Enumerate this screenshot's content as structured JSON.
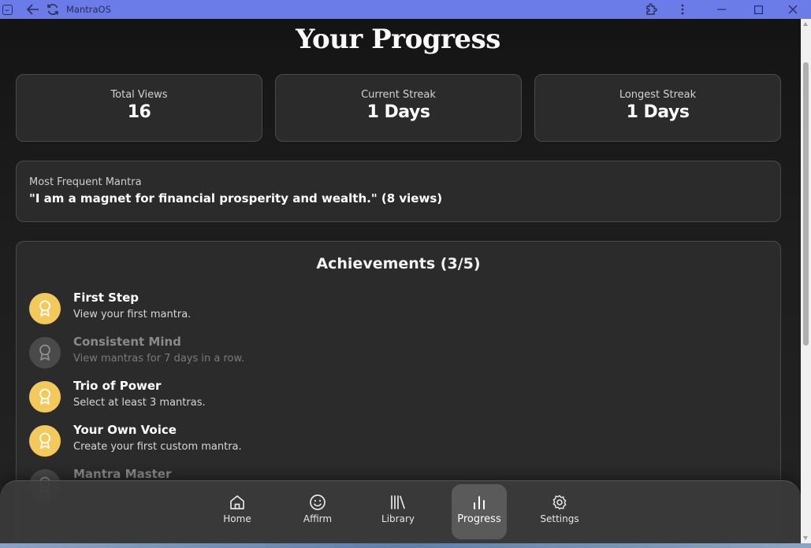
{
  "window": {
    "title": "MantraOS"
  },
  "page": {
    "title": "Your Progress"
  },
  "stats": [
    {
      "label": "Total Views",
      "value": "16"
    },
    {
      "label": "Current Streak",
      "value": "1 Days"
    },
    {
      "label": "Longest Streak",
      "value": "1 Days"
    }
  ],
  "most_frequent": {
    "label": "Most Frequent Mantra",
    "value": "\"I am a magnet for financial prosperity and wealth.\" (8 views)"
  },
  "achievements": {
    "title": "Achievements (3/5)",
    "items": [
      {
        "name": "First Step",
        "desc": "View your first mantra.",
        "unlocked": true
      },
      {
        "name": "Consistent Mind",
        "desc": "View mantras for 7 days in a row.",
        "unlocked": false
      },
      {
        "name": "Trio of Power",
        "desc": "Select at least 3 mantras.",
        "unlocked": true
      },
      {
        "name": "Your Own Voice",
        "desc": "Create your first custom mantra.",
        "unlocked": true
      },
      {
        "name": "Mantra Master",
        "desc": "",
        "unlocked": false
      }
    ]
  },
  "nav": {
    "items": [
      {
        "label": "Home",
        "icon": "home-icon"
      },
      {
        "label": "Affirm",
        "icon": "smile-icon"
      },
      {
        "label": "Library",
        "icon": "library-icon"
      },
      {
        "label": "Progress",
        "icon": "bar-chart-icon",
        "active": true
      },
      {
        "label": "Settings",
        "icon": "gear-icon"
      }
    ]
  },
  "colors": {
    "accent_gold": "#f3c95c",
    "titlebar": "#6b7be8"
  }
}
